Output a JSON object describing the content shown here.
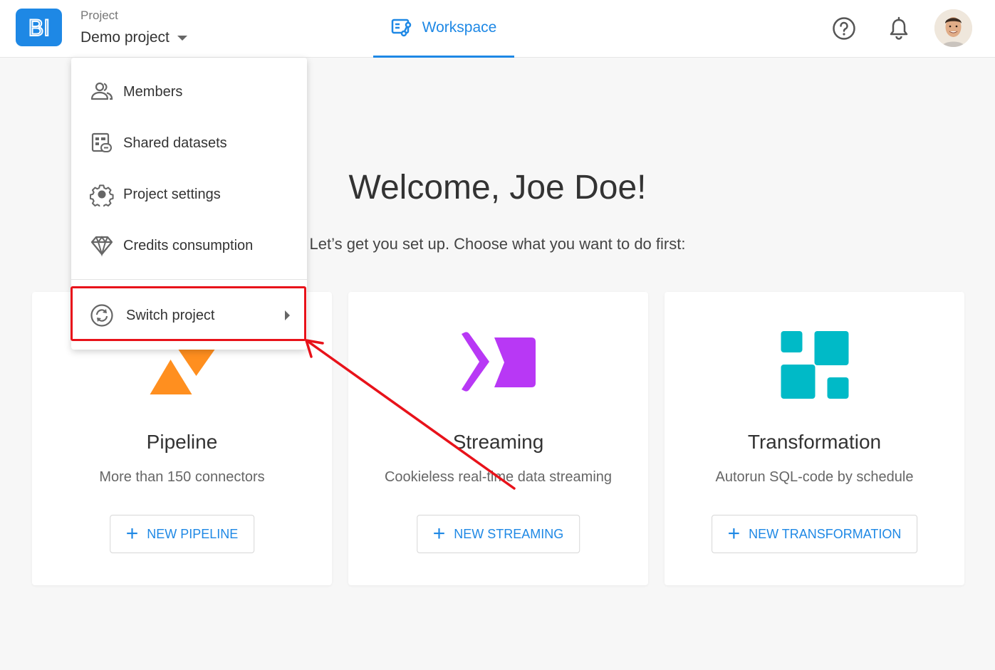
{
  "header": {
    "logo_text": "BI",
    "project_label": "Project",
    "project_name": "Demo project",
    "workspace_tab": "Workspace"
  },
  "welcome": {
    "title": "Welcome, Joe Doe!",
    "subtitle": "Let’s get you set up. Choose what you want to do first:"
  },
  "cards": [
    {
      "title": "Pipeline",
      "description": "More than 150 connectors",
      "button": "NEW PIPELINE",
      "icon": "pipeline-icon",
      "color": "#ff8f1f"
    },
    {
      "title": "Streaming",
      "description": "Cookieless real-time data streaming",
      "button": "NEW STREAMING",
      "icon": "streaming-icon",
      "color": "#b838f5"
    },
    {
      "title": "Transformation",
      "description": "Autorun SQL-code by schedule",
      "button": "NEW TRANSFORMATION",
      "icon": "transformation-icon",
      "color": "#00bac7"
    }
  ],
  "dropdown": {
    "items": [
      {
        "label": "Members",
        "icon": "members-icon"
      },
      {
        "label": "Shared datasets",
        "icon": "shared-datasets-icon"
      },
      {
        "label": "Project settings",
        "icon": "gear-icon"
      },
      {
        "label": "Credits consumption",
        "icon": "diamond-icon"
      }
    ],
    "switch_project": {
      "label": "Switch project",
      "icon": "switch-icon"
    }
  },
  "colors": {
    "primary": "#1e88e5",
    "highlight": "#e8121a",
    "text": "#333333"
  }
}
